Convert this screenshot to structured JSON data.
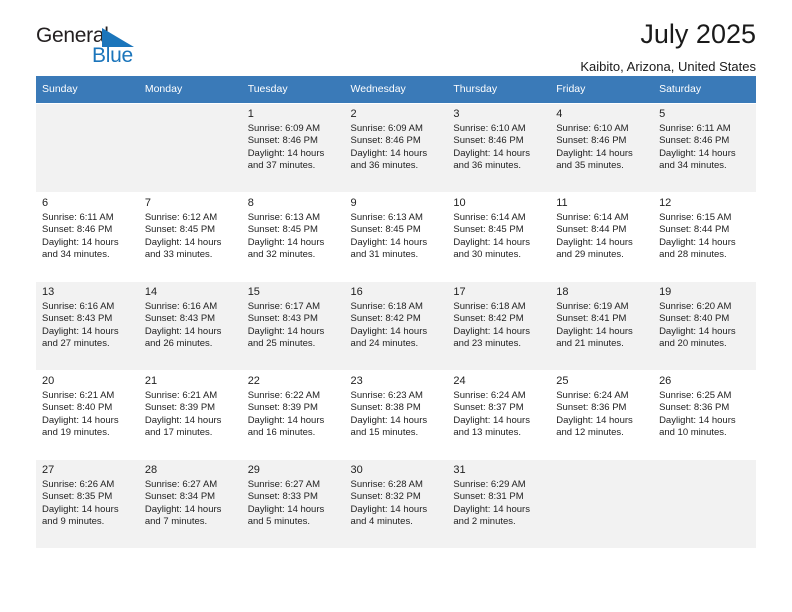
{
  "brand": {
    "name_top": "General",
    "name_bottom": "Blue",
    "triangle_color": "#1b75bb",
    "text_color": "#231f20"
  },
  "header": {
    "title": "July 2025",
    "subtitle": "Kaibito, Arizona, United States"
  },
  "theme": {
    "header_row_bg": "#3a7ab8",
    "header_row_text": "#ffffff",
    "shaded_row_bg": "#f2f2f2",
    "plain_row_bg": "#ffffff"
  },
  "weekdays": [
    "Sunday",
    "Monday",
    "Tuesday",
    "Wednesday",
    "Thursday",
    "Friday",
    "Saturday"
  ],
  "weeks": [
    {
      "shaded": true,
      "days": [
        {
          "day": "",
          "info": ""
        },
        {
          "day": "",
          "info": ""
        },
        {
          "day": "1",
          "info": "Sunrise: 6:09 AM\nSunset: 8:46 PM\nDaylight: 14 hours\nand 37 minutes."
        },
        {
          "day": "2",
          "info": "Sunrise: 6:09 AM\nSunset: 8:46 PM\nDaylight: 14 hours\nand 36 minutes."
        },
        {
          "day": "3",
          "info": "Sunrise: 6:10 AM\nSunset: 8:46 PM\nDaylight: 14 hours\nand 36 minutes."
        },
        {
          "day": "4",
          "info": "Sunrise: 6:10 AM\nSunset: 8:46 PM\nDaylight: 14 hours\nand 35 minutes."
        },
        {
          "day": "5",
          "info": "Sunrise: 6:11 AM\nSunset: 8:46 PM\nDaylight: 14 hours\nand 34 minutes."
        }
      ]
    },
    {
      "shaded": false,
      "days": [
        {
          "day": "6",
          "info": "Sunrise: 6:11 AM\nSunset: 8:46 PM\nDaylight: 14 hours\nand 34 minutes."
        },
        {
          "day": "7",
          "info": "Sunrise: 6:12 AM\nSunset: 8:45 PM\nDaylight: 14 hours\nand 33 minutes."
        },
        {
          "day": "8",
          "info": "Sunrise: 6:13 AM\nSunset: 8:45 PM\nDaylight: 14 hours\nand 32 minutes."
        },
        {
          "day": "9",
          "info": "Sunrise: 6:13 AM\nSunset: 8:45 PM\nDaylight: 14 hours\nand 31 minutes."
        },
        {
          "day": "10",
          "info": "Sunrise: 6:14 AM\nSunset: 8:45 PM\nDaylight: 14 hours\nand 30 minutes."
        },
        {
          "day": "11",
          "info": "Sunrise: 6:14 AM\nSunset: 8:44 PM\nDaylight: 14 hours\nand 29 minutes."
        },
        {
          "day": "12",
          "info": "Sunrise: 6:15 AM\nSunset: 8:44 PM\nDaylight: 14 hours\nand 28 minutes."
        }
      ]
    },
    {
      "shaded": true,
      "days": [
        {
          "day": "13",
          "info": "Sunrise: 6:16 AM\nSunset: 8:43 PM\nDaylight: 14 hours\nand 27 minutes."
        },
        {
          "day": "14",
          "info": "Sunrise: 6:16 AM\nSunset: 8:43 PM\nDaylight: 14 hours\nand 26 minutes."
        },
        {
          "day": "15",
          "info": "Sunrise: 6:17 AM\nSunset: 8:43 PM\nDaylight: 14 hours\nand 25 minutes."
        },
        {
          "day": "16",
          "info": "Sunrise: 6:18 AM\nSunset: 8:42 PM\nDaylight: 14 hours\nand 24 minutes."
        },
        {
          "day": "17",
          "info": "Sunrise: 6:18 AM\nSunset: 8:42 PM\nDaylight: 14 hours\nand 23 minutes."
        },
        {
          "day": "18",
          "info": "Sunrise: 6:19 AM\nSunset: 8:41 PM\nDaylight: 14 hours\nand 21 minutes."
        },
        {
          "day": "19",
          "info": "Sunrise: 6:20 AM\nSunset: 8:40 PM\nDaylight: 14 hours\nand 20 minutes."
        }
      ]
    },
    {
      "shaded": false,
      "days": [
        {
          "day": "20",
          "info": "Sunrise: 6:21 AM\nSunset: 8:40 PM\nDaylight: 14 hours\nand 19 minutes."
        },
        {
          "day": "21",
          "info": "Sunrise: 6:21 AM\nSunset: 8:39 PM\nDaylight: 14 hours\nand 17 minutes."
        },
        {
          "day": "22",
          "info": "Sunrise: 6:22 AM\nSunset: 8:39 PM\nDaylight: 14 hours\nand 16 minutes."
        },
        {
          "day": "23",
          "info": "Sunrise: 6:23 AM\nSunset: 8:38 PM\nDaylight: 14 hours\nand 15 minutes."
        },
        {
          "day": "24",
          "info": "Sunrise: 6:24 AM\nSunset: 8:37 PM\nDaylight: 14 hours\nand 13 minutes."
        },
        {
          "day": "25",
          "info": "Sunrise: 6:24 AM\nSunset: 8:36 PM\nDaylight: 14 hours\nand 12 minutes."
        },
        {
          "day": "26",
          "info": "Sunrise: 6:25 AM\nSunset: 8:36 PM\nDaylight: 14 hours\nand 10 minutes."
        }
      ]
    },
    {
      "shaded": true,
      "days": [
        {
          "day": "27",
          "info": "Sunrise: 6:26 AM\nSunset: 8:35 PM\nDaylight: 14 hours\nand 9 minutes."
        },
        {
          "day": "28",
          "info": "Sunrise: 6:27 AM\nSunset: 8:34 PM\nDaylight: 14 hours\nand 7 minutes."
        },
        {
          "day": "29",
          "info": "Sunrise: 6:27 AM\nSunset: 8:33 PM\nDaylight: 14 hours\nand 5 minutes."
        },
        {
          "day": "30",
          "info": "Sunrise: 6:28 AM\nSunset: 8:32 PM\nDaylight: 14 hours\nand 4 minutes."
        },
        {
          "day": "31",
          "info": "Sunrise: 6:29 AM\nSunset: 8:31 PM\nDaylight: 14 hours\nand 2 minutes."
        },
        {
          "day": "",
          "info": ""
        },
        {
          "day": "",
          "info": ""
        }
      ]
    }
  ]
}
